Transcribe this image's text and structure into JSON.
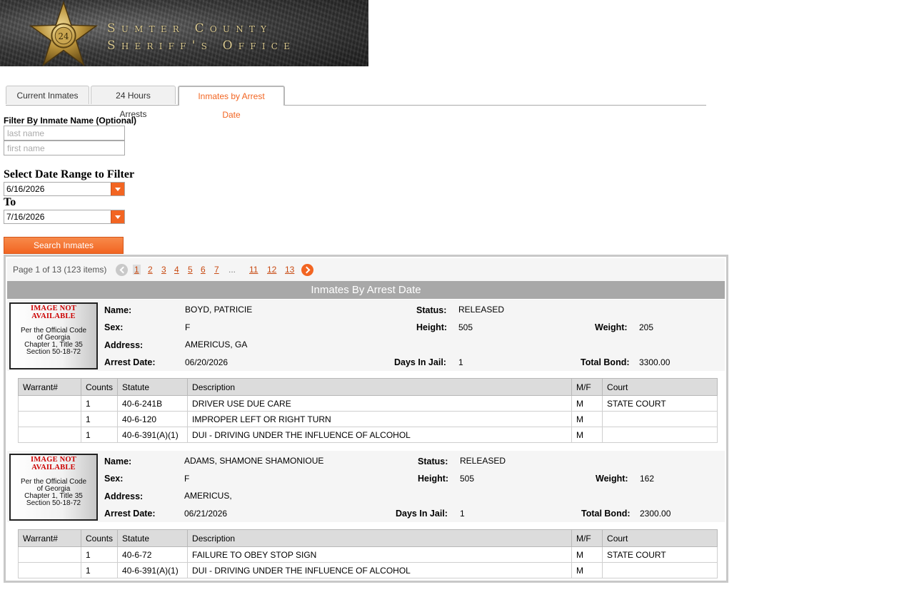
{
  "banner": {
    "line1": "Sumter County",
    "line2": "Sheriff's Office",
    "badge_number": "24"
  },
  "tabs": [
    {
      "label": "Current Inmates",
      "active": false
    },
    {
      "label": "24 Hours Arrests",
      "active": false
    },
    {
      "label": "Inmates by Arrest Date",
      "active": true
    }
  ],
  "filter": {
    "name_label": "Filter By Inmate Name (Optional)",
    "last_placeholder": "last name",
    "first_placeholder": "first name",
    "date_label": "Select Date Range to Filter",
    "from_date": "6/16/2026",
    "to_label": "To",
    "to_date": "7/16/2026",
    "search_button": "Search Inmates"
  },
  "pager": {
    "info": "Page 1 of 13 (123 items)",
    "pages": [
      "1",
      "2",
      "3",
      "4",
      "5",
      "6",
      "7",
      "11",
      "12",
      "13"
    ],
    "ellipsis": "...",
    "current": "1"
  },
  "grid_title": "Inmates By Arrest Date",
  "photo": {
    "not_available": "IMAGE NOT AVAILABLE",
    "code_lines": [
      "Per the Official Code",
      "of Georgia",
      "Chapter 1, Title 35",
      "Section 50-18-72"
    ]
  },
  "labels": {
    "name": "Name:",
    "sex": "Sex:",
    "address": "Address:",
    "arrest_date": "Arrest Date:",
    "status": "Status:",
    "height": "Height:",
    "days_in_jail": "Days In Jail:",
    "weight": "Weight:",
    "total_bond": "Total Bond:"
  },
  "charge_headers": [
    "Warrant#",
    "Counts",
    "Statute",
    "Description",
    "M/F",
    "Court"
  ],
  "records": [
    {
      "name": "BOYD, PATRICIE",
      "sex": "F",
      "address": "AMERICUS, GA",
      "arrest_date": "06/20/2026",
      "status": "RELEASED",
      "height": "505",
      "days_in_jail": "1",
      "weight": "205",
      "total_bond": "3300.00",
      "charges": [
        {
          "warrant": "",
          "counts": "1",
          "statute": "40-6-241B",
          "description": "DRIVER USE DUE CARE",
          "mf": "M",
          "court": "STATE COURT"
        },
        {
          "warrant": "",
          "counts": "1",
          "statute": "40-6-120",
          "description": "IMPROPER LEFT OR RIGHT TURN",
          "mf": "M",
          "court": ""
        },
        {
          "warrant": "",
          "counts": "1",
          "statute": "40-6-391(A)(1)",
          "description": "DUI - DRIVING UNDER THE INFLUENCE OF ALCOHOL",
          "mf": "M",
          "court": ""
        }
      ]
    },
    {
      "name": "ADAMS, SHAMONE SHAMONIOUE",
      "sex": "F",
      "address": "AMERICUS,",
      "arrest_date": "06/21/2026",
      "status": "RELEASED",
      "height": "505",
      "days_in_jail": "1",
      "weight": "162",
      "total_bond": "2300.00",
      "charges": [
        {
          "warrant": "",
          "counts": "1",
          "statute": "40-6-72",
          "description": "FAILURE TO OBEY STOP SIGN",
          "mf": "M",
          "court": "STATE COURT"
        },
        {
          "warrant": "",
          "counts": "1",
          "statute": "40-6-391(A)(1)",
          "description": "DUI - DRIVING UNDER THE INFLUENCE OF ALCOHOL",
          "mf": "M",
          "court": ""
        }
      ]
    }
  ],
  "colors": {
    "accent": "#f26522",
    "header_gray": "#a8a8a8"
  }
}
